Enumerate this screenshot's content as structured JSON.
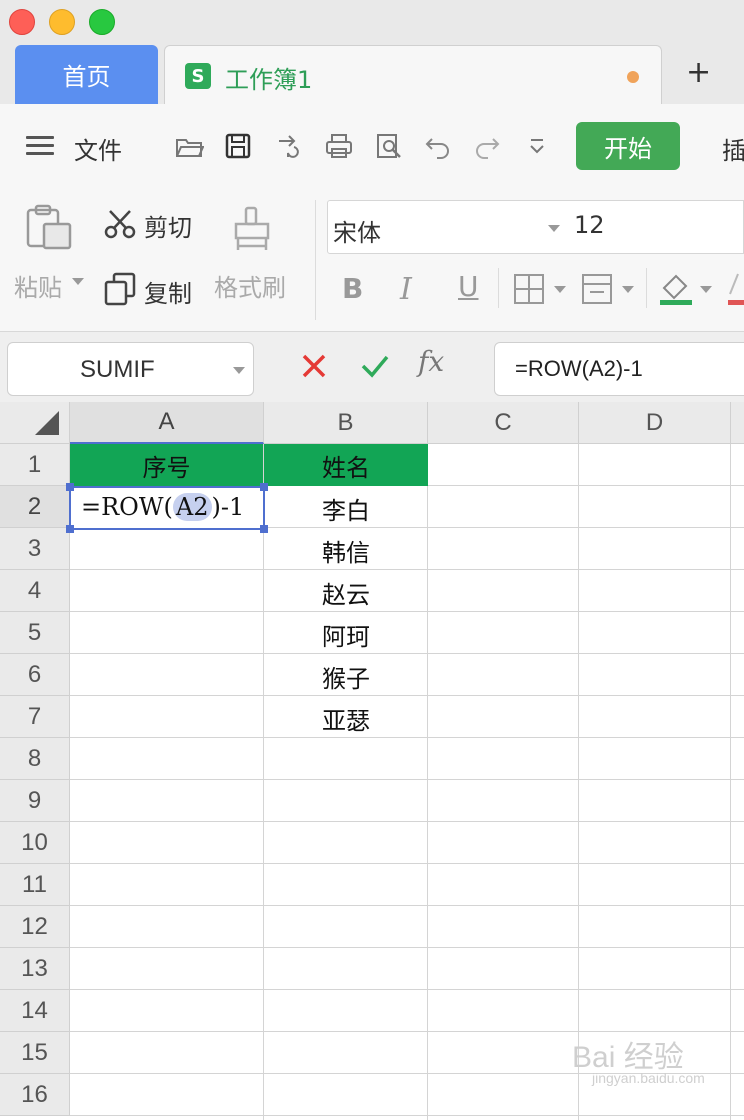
{
  "tabs": {
    "home_label": "首页",
    "doc_icon_letter": "S",
    "doc_title": "工作簿1",
    "add_label": "+"
  },
  "menu": {
    "file_label": "文件",
    "start_label": "开始",
    "insert_label": "插"
  },
  "ribbon": {
    "paste_label": "粘贴",
    "cut_label": "剪切",
    "copy_label": "复制",
    "format_painter_label": "格式刷",
    "font_name": "宋体",
    "font_size": "12",
    "bold_label": "B",
    "italic_label": "I",
    "underline_label": "U"
  },
  "formula_bar": {
    "name_box": "SUMIF",
    "fx_label": "fx",
    "formula": "=ROW(A2)-1"
  },
  "columns": [
    "A",
    "B",
    "C",
    "D"
  ],
  "rows": [
    "1",
    "2",
    "3",
    "4",
    "5",
    "6",
    "7",
    "8",
    "9",
    "10",
    "11",
    "12",
    "13",
    "14",
    "15",
    "16"
  ],
  "cells": {
    "A1": "序号",
    "B1": "姓名",
    "A2_prefix": "=ROW(",
    "A2_ref": "A2",
    "A2_suffix": ")-1",
    "B2": "李白",
    "B3": "韩信",
    "B4": "赵云",
    "B5": "阿珂",
    "B6": "猴子",
    "B7": "亚瑟"
  },
  "colors": {
    "header_fill": "#12a555",
    "selection": "#4f6fcf",
    "start_button": "#43a956",
    "home_tab": "#5b8ff0"
  },
  "watermark": {
    "text": "Bai 经验",
    "url": "jingyan.baidu.com"
  }
}
